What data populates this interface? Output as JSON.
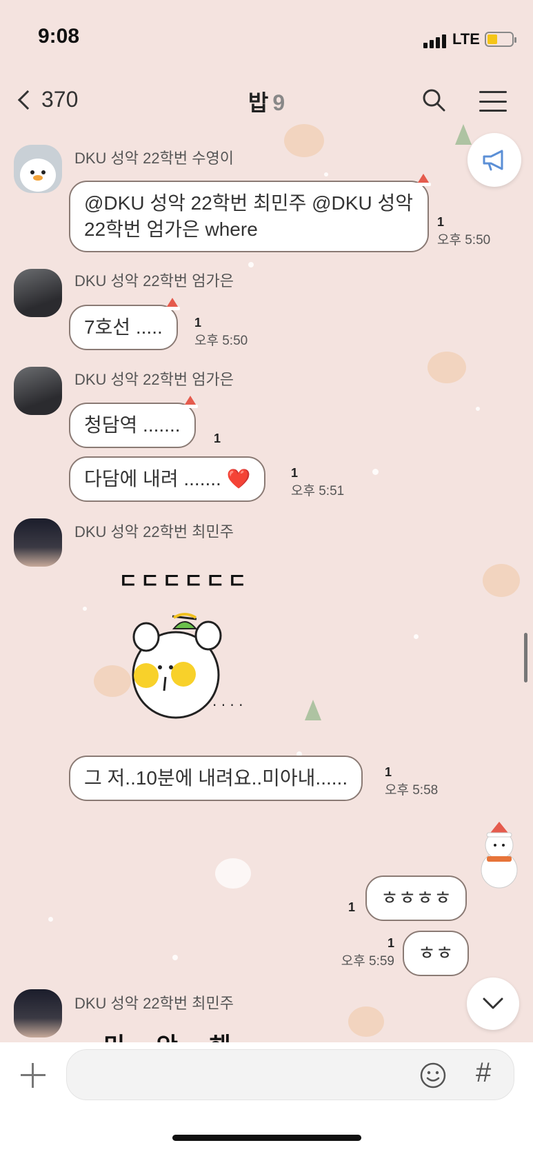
{
  "status_bar": {
    "time": "9:08",
    "network": "LTE"
  },
  "header": {
    "back_count": "370",
    "title": "밥",
    "member_count": "9"
  },
  "messages": [
    {
      "sender": "DKU 성악 22학번 수영이",
      "text": "@DKU 성악 22학번 최민주 @DKU 성악 22학번 엄가은 where",
      "read": "1",
      "time": "오후 5:50"
    },
    {
      "sender": "DKU 성악 22학번 엄가은",
      "text": "7호선 .....",
      "read": "1",
      "time": "오후 5:50"
    },
    {
      "sender": "DKU 성악 22학번 엄가은",
      "text": "청담역 .......",
      "read": "1",
      "time": ""
    },
    {
      "sender": "",
      "text": "다담에 내려 ....... ❤️",
      "read": "1",
      "time": "오후 5:51"
    },
    {
      "sender": "DKU 성악 22학번 최민주",
      "sticker_text": "ㄷㄷㄷㄷㄷㄷ",
      "text": "그 저..10분에 내려요..미아내......",
      "read": "1",
      "time": "오후 5:58"
    },
    {
      "mine": true,
      "text": "ㅎㅎㅎㅎ",
      "read": "1",
      "time": ""
    },
    {
      "mine": true,
      "text": "ㅎㅎ",
      "read": "1",
      "time": "오후 5:59"
    },
    {
      "sender": "DKU 성악 22학번 최민주",
      "partial": "미 안 해"
    }
  ],
  "input": {
    "placeholder": ""
  },
  "colors": {
    "background": "#f4e3df",
    "bubble_border": "#8a7a74",
    "battery": "#f5c518",
    "notice_icon": "#5b8fd6"
  }
}
